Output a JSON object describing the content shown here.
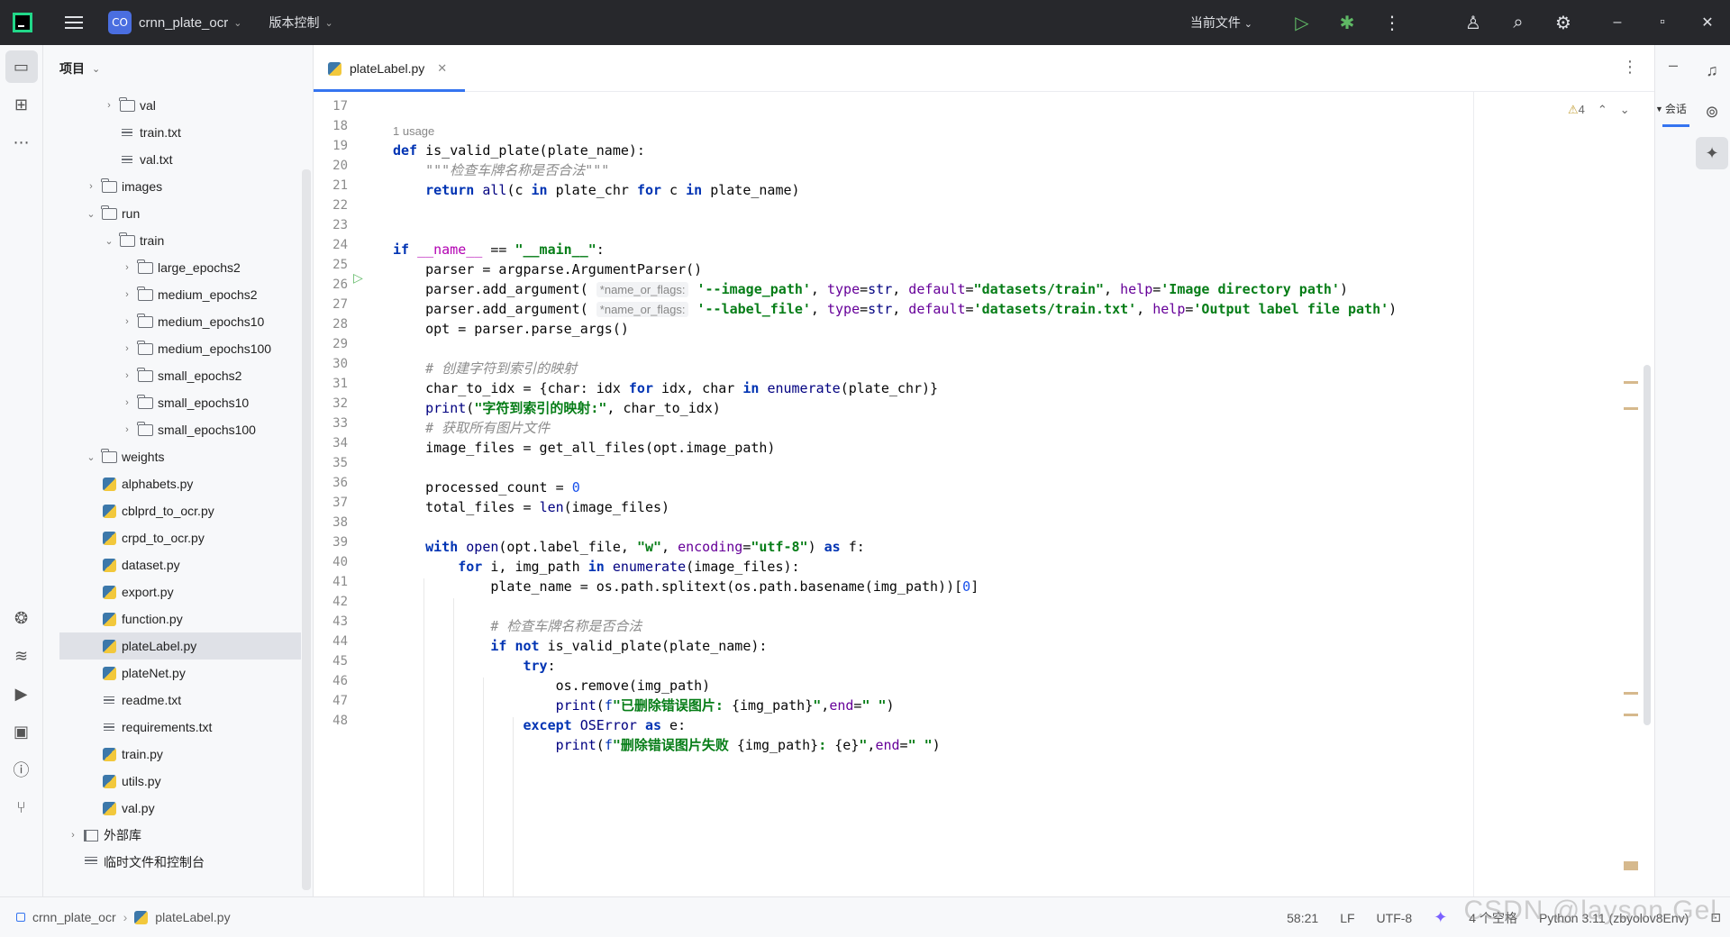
{
  "titlebar": {
    "project_badge": "CO",
    "project_name": "crnn_plate_ocr",
    "vcs": "版本控制",
    "current_file": "当前文件",
    "icons": [
      "run-icon",
      "debug-icon",
      "more-icon",
      "add-user-icon",
      "search-icon",
      "settings-icon",
      "minimize-icon",
      "restore-icon",
      "close-icon"
    ]
  },
  "project_panel": {
    "title": "项目",
    "tree": [
      {
        "label": "val",
        "type": "folder",
        "depth": 3,
        "arrow": "›"
      },
      {
        "label": "train.txt",
        "type": "txt",
        "depth": 3,
        "arrow": ""
      },
      {
        "label": "val.txt",
        "type": "txt",
        "depth": 3,
        "arrow": ""
      },
      {
        "label": "images",
        "type": "folder",
        "depth": 2,
        "arrow": "›"
      },
      {
        "label": "run",
        "type": "folder",
        "depth": 2,
        "arrow": "⌄"
      },
      {
        "label": "train",
        "type": "folder",
        "depth": 3,
        "arrow": "⌄"
      },
      {
        "label": "large_epochs2",
        "type": "folder",
        "depth": 4,
        "arrow": "›"
      },
      {
        "label": "medium_epochs2",
        "type": "folder",
        "depth": 4,
        "arrow": "›"
      },
      {
        "label": "medium_epochs10",
        "type": "folder",
        "depth": 4,
        "arrow": "›"
      },
      {
        "label": "medium_epochs100",
        "type": "folder",
        "depth": 4,
        "arrow": "›"
      },
      {
        "label": "small_epochs2",
        "type": "folder",
        "depth": 4,
        "arrow": "›"
      },
      {
        "label": "small_epochs10",
        "type": "folder",
        "depth": 4,
        "arrow": "›"
      },
      {
        "label": "small_epochs100",
        "type": "folder",
        "depth": 4,
        "arrow": "›"
      },
      {
        "label": "weights",
        "type": "folder",
        "depth": 2,
        "arrow": "⌄"
      },
      {
        "label": "alphabets.py",
        "type": "py",
        "depth": 2,
        "arrow": ""
      },
      {
        "label": "cblprd_to_ocr.py",
        "type": "py",
        "depth": 2,
        "arrow": ""
      },
      {
        "label": "crpd_to_ocr.py",
        "type": "py",
        "depth": 2,
        "arrow": ""
      },
      {
        "label": "dataset.py",
        "type": "py",
        "depth": 2,
        "arrow": ""
      },
      {
        "label": "export.py",
        "type": "py",
        "depth": 2,
        "arrow": ""
      },
      {
        "label": "function.py",
        "type": "py",
        "depth": 2,
        "arrow": ""
      },
      {
        "label": "plateLabel.py",
        "type": "py",
        "depth": 2,
        "arrow": "",
        "selected": true
      },
      {
        "label": "plateNet.py",
        "type": "py",
        "depth": 2,
        "arrow": ""
      },
      {
        "label": "readme.txt",
        "type": "txt",
        "depth": 2,
        "arrow": ""
      },
      {
        "label": "requirements.txt",
        "type": "txt",
        "depth": 2,
        "arrow": ""
      },
      {
        "label": "train.py",
        "type": "py",
        "depth": 2,
        "arrow": ""
      },
      {
        "label": "utils.py",
        "type": "py",
        "depth": 2,
        "arrow": ""
      },
      {
        "label": "val.py",
        "type": "py",
        "depth": 2,
        "arrow": ""
      },
      {
        "label": "外部库",
        "type": "lib",
        "depth": 1,
        "arrow": "›"
      },
      {
        "label": "临时文件和控制台",
        "type": "scratch",
        "depth": 1,
        "arrow": ""
      }
    ]
  },
  "editor": {
    "tab_label": "plateLabel.py",
    "inspection_count": "4",
    "usage_hint": "1 usage",
    "param_hint": "*name_or_flags:",
    "line_numbers": [
      "17",
      "18",
      "19",
      "20",
      "21",
      "22",
      "23",
      "24",
      "25",
      "26",
      "27",
      "28",
      "29",
      "30",
      "31",
      "32",
      "33",
      "34",
      "35",
      "36",
      "37",
      "38",
      "39",
      "40",
      "41",
      "42",
      "43",
      "44",
      "45",
      "46",
      "47",
      "48"
    ]
  },
  "right_panel": {
    "session_label": "会话"
  },
  "statusbar": {
    "project": "crnn_plate_ocr",
    "file": "plateLabel.py",
    "position": "58:21",
    "line_sep": "LF",
    "encoding": "UTF-8",
    "indent": "4 个空格",
    "interpreter": "Python 3.11 (zbyolov8Env)",
    "watermark": "CSDN @layson Gel"
  }
}
